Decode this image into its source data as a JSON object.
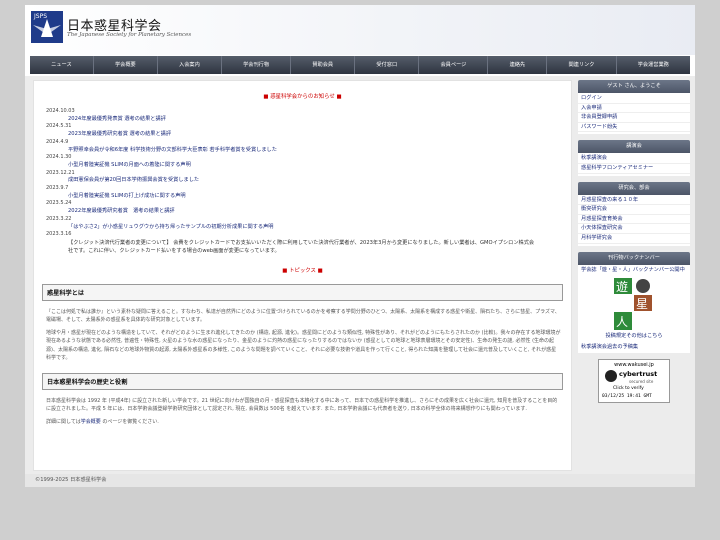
{
  "header": {
    "logo_text": "JSPS",
    "title": "日本惑星科学会",
    "subtitle": "The Japanese Society for Planetary Sciences"
  },
  "nav": [
    "ニュース",
    "学会概要",
    "入会案内",
    "学会刊行物",
    "賛助会員",
    "受付窓口",
    "会員ページ",
    "連絡先",
    "関連リンク",
    "学会運営業務"
  ],
  "notice": {
    "title": "■ 惑星科学会からのお知らせ ■",
    "items": [
      {
        "date": "2024.10.03",
        "text": "2024年度最優秀発表賞 選考の結果と講評"
      },
      {
        "date": "2024.5.31",
        "text": "2023年度最優秀研究者賞 選考の結果と講評"
      },
      {
        "date": "2024.4.9",
        "text": "平野照幸会員が令和6年度 科学技術分野の文部科学大臣表彰 若手科学者賞を受賞しました"
      },
      {
        "date": "2024.1.30",
        "text": "小型月着陸実証機 SLIMの月面への着陸に関する声明"
      },
      {
        "date": "2023.12.21",
        "text": "成田憲保会員が第20回日本学術振興会賞を受賞しました"
      },
      {
        "date": "2023.9.7",
        "text": "小型月着陸実証機 SLIMの打上げ成功に関する声明"
      },
      {
        "date": "2023.5.24",
        "text": "2022年度最優秀研究者賞　選考の結果と講評"
      },
      {
        "date": "2023.3.22",
        "text": "「はやぶさ2」が小惑星リュウグウから持ち帰ったサンプルの初期分析成果に関する声明"
      },
      {
        "date": "2023.3.16",
        "text": ""
      }
    ],
    "note": "【クレジット決済代行業者の変更について】 会費をクレジットカードでお支払いいただく際に利用していた決済代行業者が、2023年3月から変更になりました。新しい業者は、GMOイプシロン株式会社です。これに伴い、クレジットカード払いをする場合のweb画面が変更になっています。"
  },
  "topics": {
    "title": "■ トピックス ■"
  },
  "about": {
    "heading": "惑星科学とは",
    "para1": "『ここは何処で私は誰か』という素朴な疑問に答えること。すなわち、私達が自然界にどのように位置づけられているのかを考察する学問分野のひとつ、太陽系、太陽系を構成する惑星や衛星、隕石たち、さらに彗星、プラズマ、電磁場、そして、太陽系外の惑星系を具体的な研究対象としています。",
    "para2": "地球や月・惑星が現在どのような構造をしていて、それがどのように生まれ進化してきたのか (構造, 起源, 進化)。惑星間にどのような類似性, 特殊性があり、それがどのようにもたらされたのか (比較)。我々の存在する地球環境が現在あるような状態である必然性, 普遍性・特殊性, 火星のような水の惑星になったり、金星のように灼熱の惑星になったりするのではないか (惑星としての地球と地球表層環境とその安定性)、生命の発生の謎, 必然性 (生命の起源)、太陽系の構造, 進化, 隕石などの地球外物質の起源, 太陽系外惑星系の多様性, このような問題を調べていくこと、それに必要な技術や道具を作って行くこと, 得られた知識を整理して社会に還元普及していくこと, それが惑星科学です。"
  },
  "history": {
    "heading": "日本惑星科学会の歴史と役割",
    "para1": "日本惑星科学会は 1992 年 (平成4年) に設立された新しい学会です。21 世紀に向けわが国独自の月・惑星探査も本格化する中にあって、日本での惑星科学を推進し、さらにその成果を広く社会に還元, 知見を普及することを目的に設立されました。平成 5 年には、日本学術会議登録学術研究団体として認定され, 現在, 会員数は 500名 を越えています. また, 日本学術会議にも代表者を送り, 日本の科学全体の将来構想作りにも関わっています.",
    "para2_pre": "詳細に関しては",
    "para2_link": "学会概要",
    "para2_post": " のページを御覧ください."
  },
  "sidebar": {
    "guest": {
      "title": "ゲスト さん、ようこそ",
      "links": [
        "ログイン",
        "入会申請",
        "非会員登録申請",
        "パスワード紛失"
      ]
    },
    "lectures": {
      "title": "講演会",
      "links": [
        "秋季講演会",
        "惑星科学フロンティアセミナー"
      ]
    },
    "research": {
      "title": "研究会、部会",
      "links": [
        "月惑星探査の来る１０年",
        "衝突研究会",
        "月惑星探査育英会",
        "小天体探査研究会",
        "月科学研究会"
      ]
    },
    "backnumber": {
      "title": "刊行物バックナンバー",
      "text": "学会誌「遊・星・人」バックナンバー公開中",
      "cover_chars": [
        "遊",
        "星",
        "人"
      ],
      "submit_pre": "投稿規定その他は",
      "submit_link": "こちら",
      "archive": "秋季講演会過去の予稿集"
    },
    "banner": {
      "url_text": "www.wakusei.jp",
      "brand": "cybertrust",
      "sub": "secured site",
      "click": "Click to verify",
      "stamp": "03/12/25 19:41 GMT"
    }
  },
  "footer": {
    "copyright": "©1999-2025 日本惑星科学会"
  },
  "colors": {
    "nav_bg": "#3a4150",
    "section_red": "#cc0000",
    "link_blue": "#1a2a7a"
  }
}
